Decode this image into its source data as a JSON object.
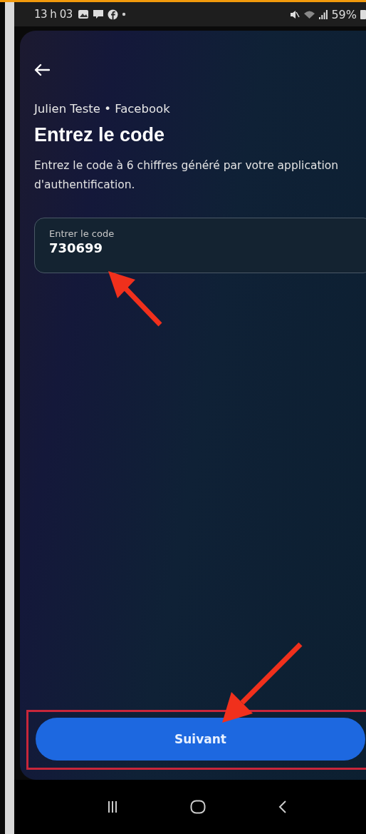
{
  "status_bar": {
    "time": "13 h 03",
    "battery": "59%"
  },
  "screen": {
    "account": "Julien Teste • Facebook",
    "title": "Entrez le code",
    "description": "Entrez le code à 6 chiffres généré par votre application d'authentification.",
    "code_field": {
      "label": "Entrer le code",
      "value": "730699"
    },
    "next_button": {
      "label": "Suivant",
      "highlighted": true
    }
  }
}
